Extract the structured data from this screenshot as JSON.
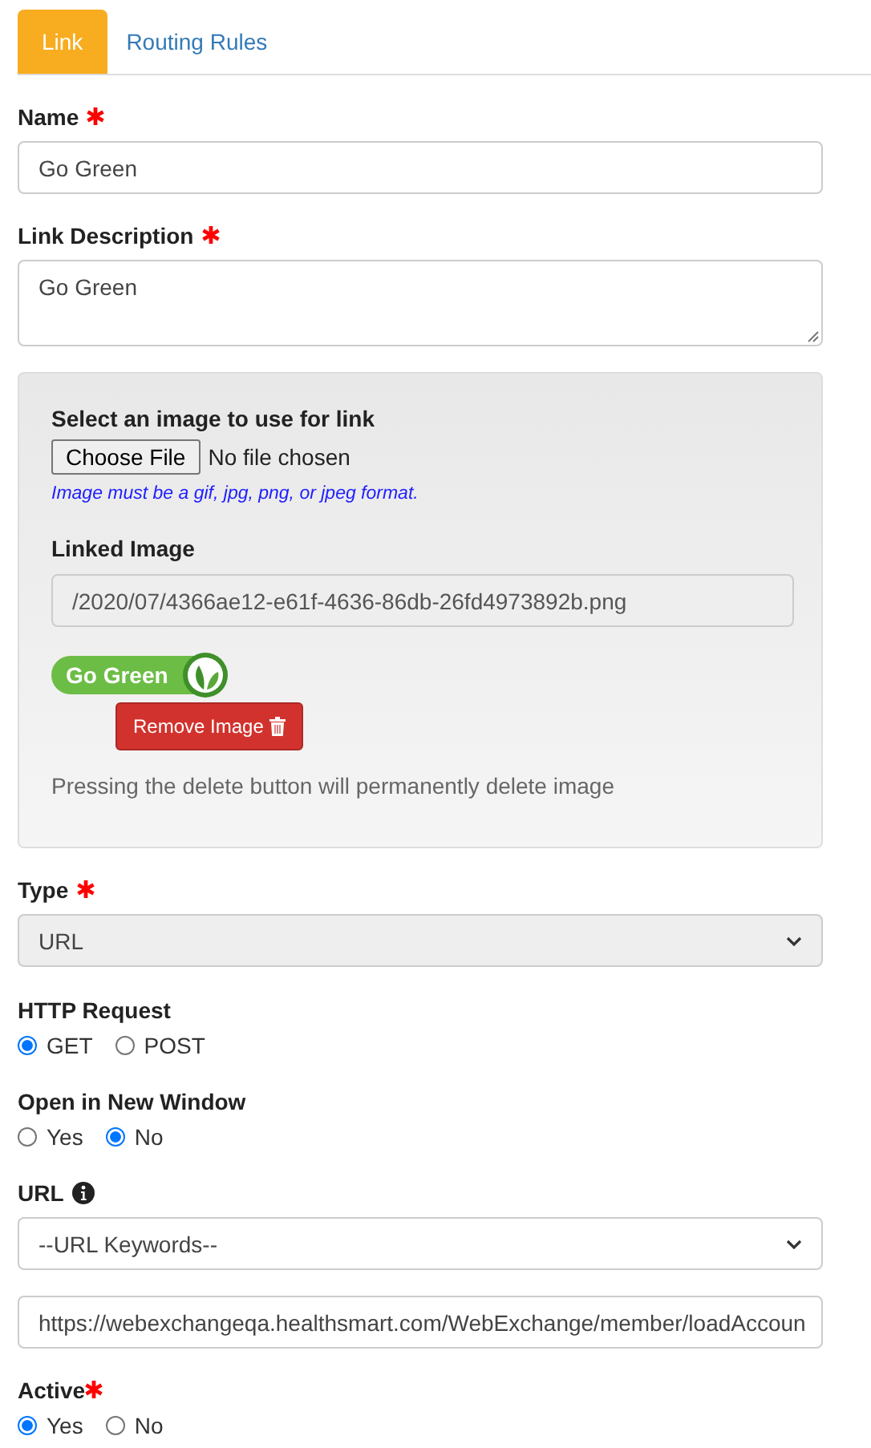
{
  "tabs": [
    {
      "label": "Link",
      "selected": true
    },
    {
      "label": "Routing Rules",
      "selected": false
    }
  ],
  "name": {
    "label": "Name",
    "required": true,
    "value": "Go Green"
  },
  "description": {
    "label": "Link Description",
    "required": true,
    "value": "Go Green"
  },
  "image_panel": {
    "select_label": "Select an image to use for link",
    "choose_button": "Choose File",
    "file_status": "No file chosen",
    "hint": "Image must be a gif, jpg, png, or jpeg format.",
    "linked_label": "Linked Image",
    "linked_value": "/2020/07/4366ae12-e61f-4636-86db-26fd4973892b.png",
    "logo_text": "Go Green",
    "remove_button": "Remove Image",
    "note": "Pressing the delete button will permanently delete image"
  },
  "type": {
    "label": "Type",
    "required": true,
    "value": "URL",
    "disabled": true
  },
  "http_request": {
    "label": "HTTP Request",
    "options": [
      {
        "label": "GET",
        "selected": true
      },
      {
        "label": "POST",
        "selected": false
      }
    ]
  },
  "open_in_new_window": {
    "label": "Open in New Window",
    "options": [
      {
        "label": "Yes",
        "selected": false
      },
      {
        "label": "No",
        "selected": true
      }
    ]
  },
  "url": {
    "label": "URL",
    "keywords": "--URL Keywords--",
    "value": "https://webexchangeqa.healthsmart.com/WebExchange/member/loadAccoun"
  },
  "active": {
    "label": "Active",
    "required": true,
    "options": [
      {
        "label": "Yes",
        "selected": true
      },
      {
        "label": "No",
        "selected": false
      }
    ]
  }
}
